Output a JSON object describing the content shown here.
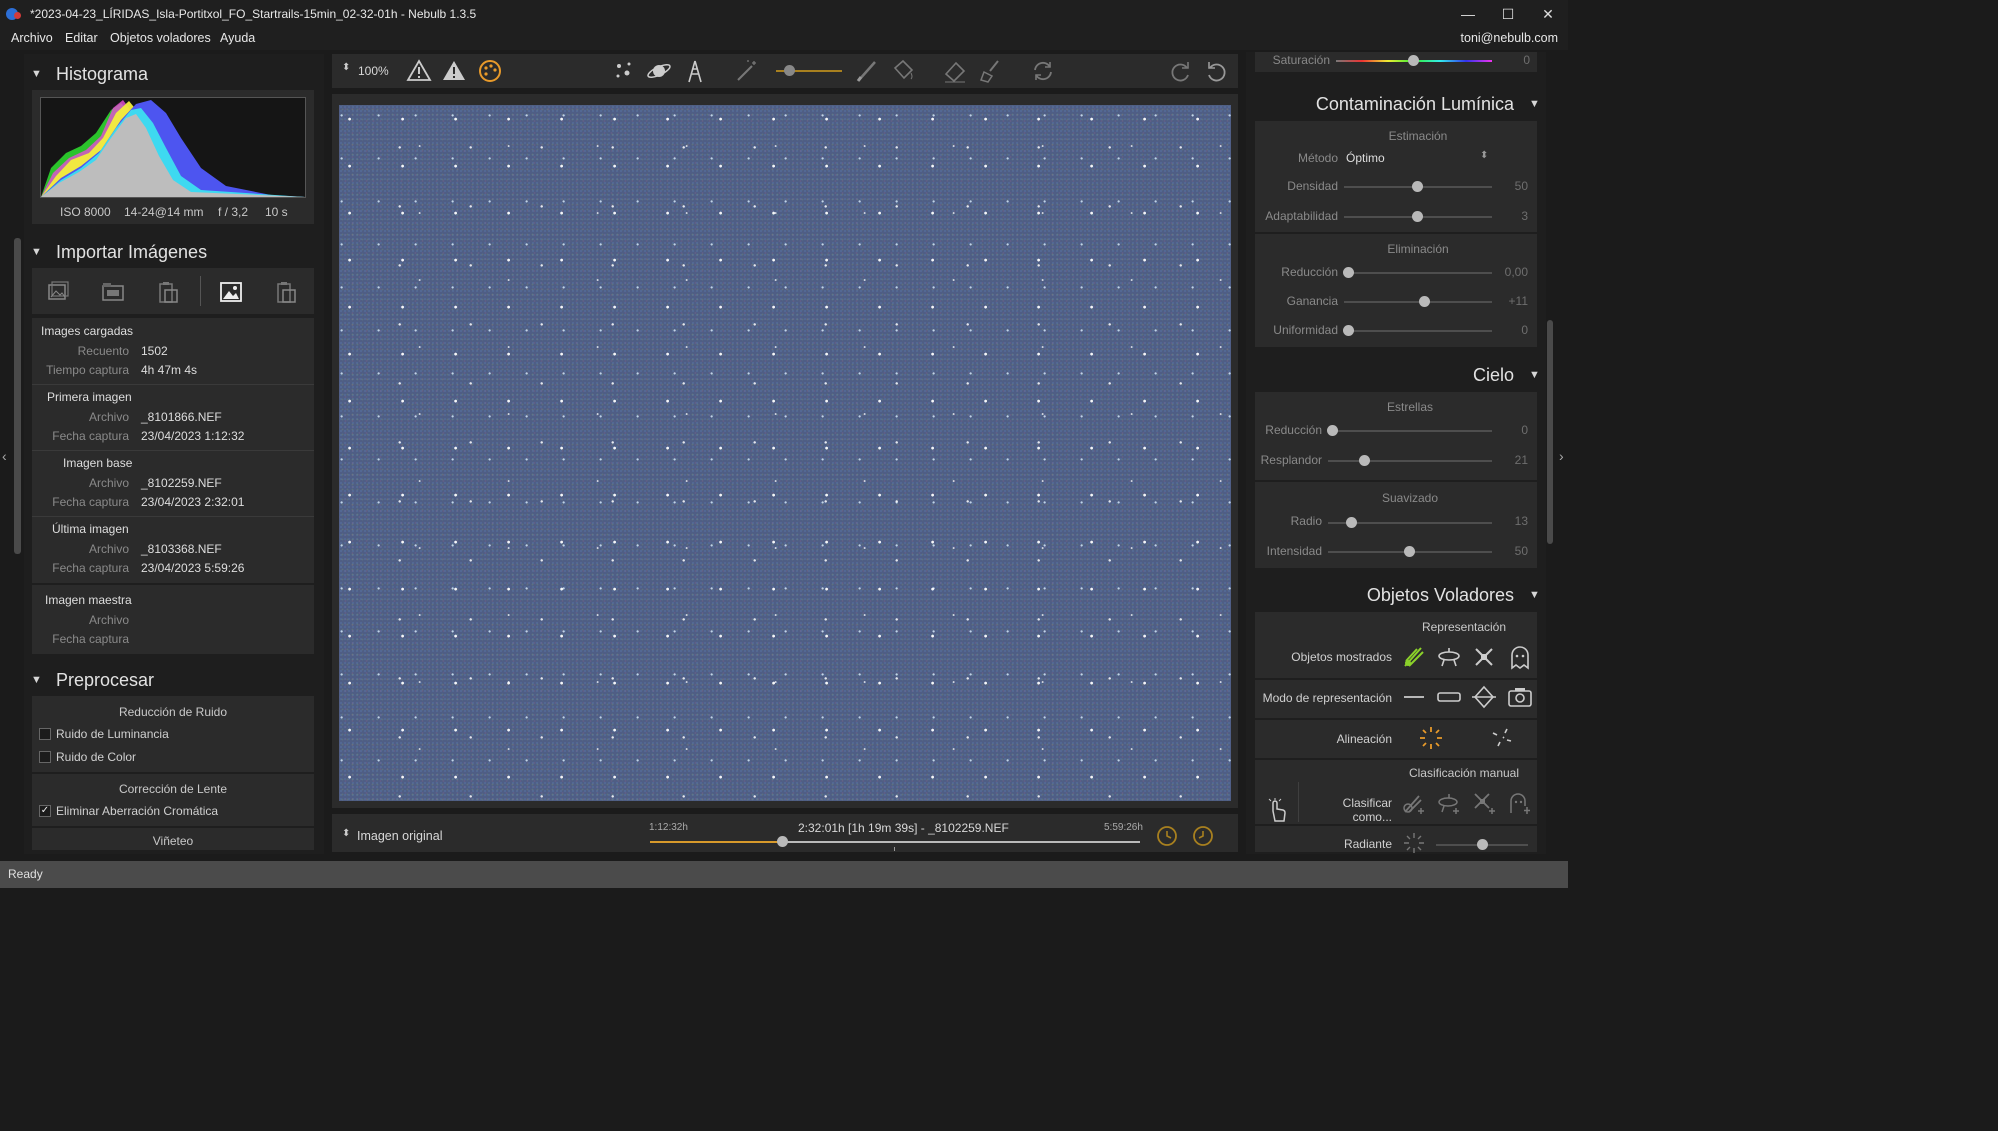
{
  "window": {
    "title": "*2023-04-23_LÍRIDAS_Isla-Portitxol_FO_Startrails-15min_02-32-01h - Nebulb 1.3.5",
    "minimize": "—",
    "maximize": "☐",
    "close": "✕"
  },
  "menu": {
    "items": [
      "Archivo",
      "Editar",
      "Objetos voladores",
      "Ayuda"
    ],
    "user": "toni@nebulb.com"
  },
  "left": {
    "histograma": {
      "title": "Histograma",
      "exif": [
        "ISO 8000",
        "14-24@14 mm",
        "f / 3,2",
        "10 s"
      ]
    },
    "importar": {
      "title": "Importar Imágenes",
      "cargadas": {
        "title": "Images cargadas",
        "recuento_label": "Recuento",
        "recuento": "1502",
        "tiempo_label": "Tiempo captura",
        "tiempo": "4h 47m 4s"
      },
      "primera": {
        "title": "Primera imagen",
        "archivo_label": "Archivo",
        "archivo": "_8101866.NEF",
        "fecha_label": "Fecha captura",
        "fecha": "23/04/2023 1:12:32"
      },
      "base": {
        "title": "Imagen base",
        "archivo_label": "Archivo",
        "archivo": "_8102259.NEF",
        "fecha_label": "Fecha captura",
        "fecha": "23/04/2023 2:32:01"
      },
      "ultima": {
        "title": "Última imagen",
        "archivo_label": "Archivo",
        "archivo": "_8103368.NEF",
        "fecha_label": "Fecha captura",
        "fecha": "23/04/2023 5:59:26"
      },
      "maestra": {
        "title": "Imagen maestra",
        "archivo_label": "Archivo",
        "fecha_label": "Fecha captura"
      }
    },
    "preprocesar": {
      "title": "Preprocesar",
      "ruido_title": "Reducción de Ruido",
      "luminancia": "Ruido de Luminancia",
      "color": "Ruido de Color",
      "lente_title": "Corrección de Lente",
      "aberracion": "Eliminar Aberración Cromática",
      "vineteo": "Viñeteo"
    }
  },
  "toolbar": {
    "zoom": "100%"
  },
  "bottom": {
    "view_mode": "Imagen original",
    "time_start": "1:12:32h",
    "time_end": "5:59:26h",
    "current": "2:32:01h [1h 19m 39s] - _8102259.NEF",
    "slider_pos": 0.27
  },
  "right": {
    "saturacion": {
      "label": "Saturación",
      "value": "0"
    },
    "contaminacion": {
      "title": "Contaminación Lumínica",
      "estimacion": "Estimación",
      "metodo_label": "Método",
      "metodo": "Óptimo",
      "densidad_label": "Densidad",
      "densidad": "50",
      "adapt_label": "Adaptabilidad",
      "adapt": "3",
      "eliminacion": "Eliminación",
      "reduccion_label": "Reducción",
      "reduccion": "0,00",
      "ganancia_label": "Ganancia",
      "ganancia": "+11",
      "uniformidad_label": "Uniformidad",
      "uniformidad": "0"
    },
    "cielo": {
      "title": "Cielo",
      "estrellas": "Estrellas",
      "reduccion_label": "Reducción",
      "reduccion": "0",
      "resplandor_label": "Resplandor",
      "resplandor": "21",
      "suavizado": "Suavizado",
      "radio_label": "Radio",
      "radio": "13",
      "intensidad_label": "Intensidad",
      "intensidad": "50"
    },
    "objetos": {
      "title": "Objetos Voladores",
      "representacion": "Representación",
      "mostrados": "Objetos mostrados",
      "modo": "Modo de representación",
      "alineacion": "Alineación",
      "clasif_manual": "Clasificación manual",
      "clasificar": "Clasificar como...",
      "radiante": "Radiante"
    }
  },
  "status": "Ready"
}
